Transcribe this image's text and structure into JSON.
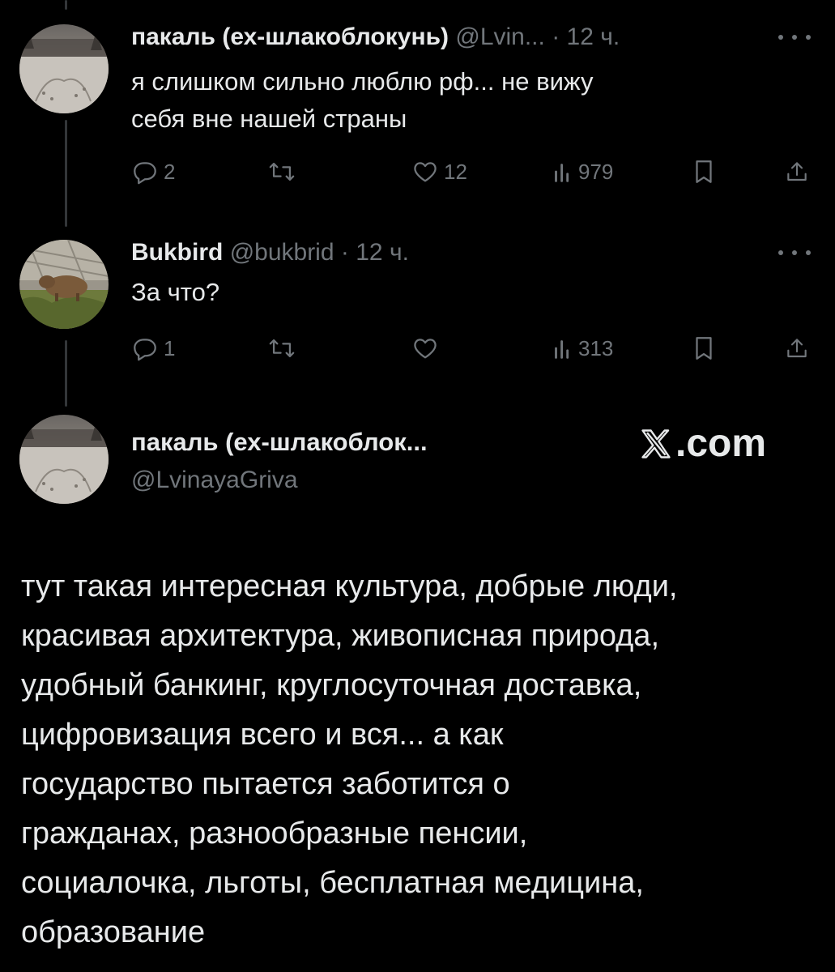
{
  "tweets": [
    {
      "name": "пакаль (ех-шлакоблокунь)",
      "handle": "@Lvin...",
      "separator": "·",
      "time": "12 ч.",
      "text_lines": [
        "я слишком сильно люблю рф... не вижу",
        "себя вне нашей страны"
      ],
      "replies": "2",
      "retweets": "",
      "likes": "12",
      "views": "979"
    },
    {
      "name": "Bukbird",
      "handle": "@bukbrid",
      "separator": "·",
      "time": "12 ч.",
      "text_lines": [
        "За что?"
      ],
      "replies": "1",
      "retweets": "",
      "likes": "",
      "views": "313"
    }
  ],
  "main_tweet": {
    "name": "пакаль (ех-шлакоблок...",
    "handle": "@LvinayaGriva",
    "brand_suffix": ".com",
    "body_lines": [
      "тут такая интересная культура, добрые люди,",
      "красивая архитектура, живописная природа,",
      "удобный банкинг, круглосуточная доставка,",
      "цифровизация всего и вся... а как",
      "государство пытается заботится о",
      "гражданах, разнообразные пенсии,",
      "социалочка, льготы, бесплатная медицина,",
      "образование"
    ]
  },
  "icons": {
    "more": "more-dots-icon",
    "reply": "reply-bubble-icon",
    "retweet": "retweet-icon",
    "like": "heart-icon",
    "views": "bar-chart-views-icon",
    "bookmark": "bookmark-icon",
    "share": "share-upload-icon",
    "brand": "x-logo-icon"
  },
  "colors": {
    "background": "#000000",
    "text_primary": "#e7e9ea",
    "text_secondary": "#71767b",
    "thread_line": "#333639"
  }
}
